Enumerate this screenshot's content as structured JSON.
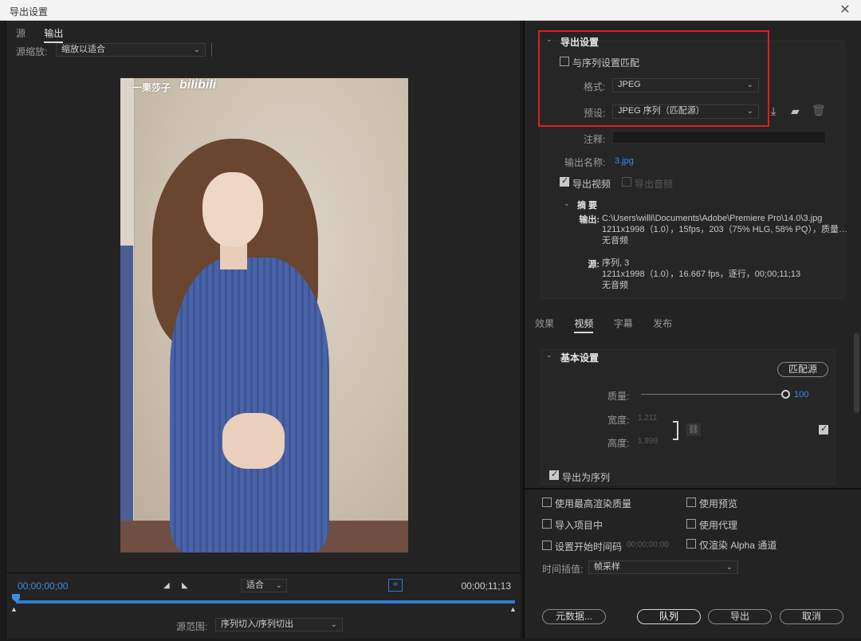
{
  "window": {
    "title": "导出设置",
    "close_glyph": "✕"
  },
  "left": {
    "tabs": [
      {
        "label": "源"
      },
      {
        "label": "输出"
      }
    ],
    "scale_label": "源缩放:",
    "scale_value": "缩放以适合",
    "preview_watermark": "一栗莎子",
    "preview_logo": "bilibili",
    "timecode_start": "00;00;00;00",
    "timecode_end": "00;00;11;13",
    "fit_value": "适合",
    "range_label": "源范围:",
    "range_value": "序列切入/序列切出"
  },
  "export": {
    "section_title": "导出设置",
    "match_sequence": {
      "label": "与序列设置匹配",
      "checked": false
    },
    "format_label": "格式:",
    "format_value": "JPEG",
    "preset_label": "预设:",
    "preset_value": "JPEG 序列（匹配源）",
    "comment_label": "注释:",
    "comment_value": "",
    "output_name_label": "输出名称:",
    "output_name_value": "3.jpg",
    "export_video": {
      "label": "导出视频",
      "checked": true
    },
    "export_audio": {
      "label": "导出音频",
      "checked": false
    },
    "summary": {
      "title": "摘 要",
      "output_label": "输出:",
      "output_lines": [
        "C:\\Users\\willi\\Documents\\Adobe\\Premiere Pro\\14.0\\3.jpg",
        "1211x1998（1.0），15fps，203（75% HLG, 58% PQ），质量…",
        "无音频"
      ],
      "source_label": "源:",
      "source_lines": [
        "序列, 3",
        "1211x1998（1.0），16.667 fps，逐行，00;00;11;13",
        "无音频"
      ]
    }
  },
  "settings_tabs": [
    {
      "label": "效果"
    },
    {
      "label": "视频"
    },
    {
      "label": "字幕"
    },
    {
      "label": "发布"
    }
  ],
  "basic": {
    "title": "基本设置",
    "match_source_button": "匹配源",
    "quality_label": "质量:",
    "quality_value": "100",
    "width_label": "宽度:",
    "width_value": "1,211",
    "height_label": "高度:",
    "height_value": "1,998",
    "export_as_sequence": {
      "label": "导出为序列",
      "checked": true
    }
  },
  "options": {
    "max_render_quality": {
      "label": "使用最高渲染质量",
      "checked": false
    },
    "use_previews": {
      "label": "使用预览",
      "checked": false
    },
    "import_into_project": {
      "label": "导入项目中",
      "checked": false
    },
    "use_proxies": {
      "label": "使用代理",
      "checked": false
    },
    "set_start_timecode": {
      "label": "设置开始时间码",
      "checked": false
    },
    "start_timecode_value": "00;00;00;00",
    "render_alpha_only": {
      "label": "仅渲染 Alpha 通道",
      "checked": false
    },
    "time_interpolation_label": "时间插值:",
    "time_interpolation_value": "帧采样"
  },
  "buttons": {
    "metadata": "元数据...",
    "queue": "队列",
    "export": "导出",
    "cancel": "取消"
  },
  "icons": {
    "save_preset": "download-icon",
    "import_preset": "folder-import-icon",
    "delete_preset": "trash-icon",
    "link": "chain-link-icon",
    "crop": "crop-icon"
  },
  "colors": {
    "accent": "#3a8fe0",
    "highlight_box": "#e01e1e",
    "background": "#232323"
  }
}
